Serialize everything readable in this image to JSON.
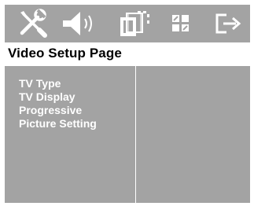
{
  "toolbar": {
    "icons": [
      "general-setup-icon",
      "audio-setup-icon",
      "video-setup-icon",
      "preference-setup-icon",
      "exit-icon"
    ]
  },
  "page": {
    "title": "Video Setup Page"
  },
  "menu": {
    "items": [
      {
        "label": "TV Type"
      },
      {
        "label": "TV Display"
      },
      {
        "label": "Progressive"
      },
      {
        "label": "Picture Setting"
      }
    ]
  },
  "colors": {
    "panel_gray": "#a3a3a3",
    "text_white": "#ffffff",
    "title_black": "#000000"
  }
}
